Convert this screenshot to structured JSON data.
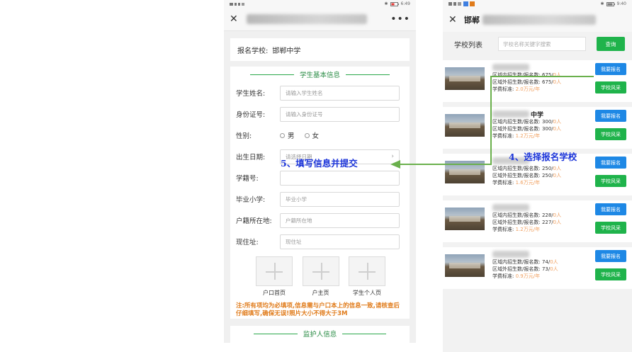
{
  "left_phone": {
    "status_time": "6:49",
    "school_label": "报名学校:",
    "school_value": "邯郸中学",
    "section_student": "学生基本信息",
    "fields": [
      {
        "label": "学生姓名:",
        "placeholder": "请输入学生姓名"
      },
      {
        "label": "身份证号:",
        "placeholder": "请输入身份证号"
      },
      {
        "label": "性别:",
        "options": [
          "男",
          "女"
        ]
      },
      {
        "label": "出生日期:",
        "placeholder": "请选择日期"
      },
      {
        "label": "学籍号:",
        "placeholder": ""
      },
      {
        "label": "毕业小学:",
        "placeholder": "毕业小学"
      },
      {
        "label": "户籍所在地:",
        "placeholder": "户籍所在地"
      },
      {
        "label": "现住址:",
        "placeholder": "现住址"
      }
    ],
    "uploads": [
      "户口首页",
      "户主页",
      "学生个人页"
    ],
    "note": "注:所有项均为必填项,信息需与户口本上的信息一致,请核查后仔细填写,确保无误!照片大小不得大于3M",
    "section_guardian": "监护人信息"
  },
  "right_phone": {
    "status_time": "9:40",
    "title": "邯郸",
    "list_label": "学校列表",
    "search_placeholder": "学校名称关键字搜索",
    "search_button": "查询",
    "items": [
      {
        "name": "",
        "in_quota": "区域内招生数/报名数: 675/",
        "in_count": "0人",
        "out_quota": "区域外招生数/报名数: 675/",
        "out_count": "0人",
        "fee_label": "学费标准:",
        "fee": "2.0万元/年"
      },
      {
        "name": "中学",
        "in_quota": "区域内招生数/报名数: 300/",
        "in_count": "0人",
        "out_quota": "区域外招生数/报名数: 300/",
        "out_count": "0人",
        "fee_label": "学费标准:",
        "fee": "1.2万元/年"
      },
      {
        "name": "",
        "in_quota": "区域内招生数/报名数: 250/",
        "in_count": "0人",
        "out_quota": "区域外招生数/报名数: 250/",
        "out_count": "0人",
        "fee_label": "学费标准:",
        "fee": "1.6万元/年"
      },
      {
        "name": "",
        "in_quota": "区域内招生数/报名数: 228/",
        "in_count": "0人",
        "out_quota": "区域外招生数/报名数: 227/",
        "out_count": "0人",
        "fee_label": "学费标准:",
        "fee": "1.2万元/年"
      },
      {
        "name": "",
        "in_quota": "区域内招生数/报名数: 74/",
        "in_count": "0人",
        "out_quota": "区域外招生数/报名数: 73/",
        "out_count": "0人",
        "fee_label": "学费标准:",
        "fee": "0.9万元/年"
      }
    ],
    "apply_button": "我要报名",
    "style_button": "学校风采"
  },
  "annotations": {
    "step5": "5、填写信息并提交",
    "step4": "4、选择报名学校"
  },
  "colors": {
    "annotation": "#1c35d9",
    "arrow": "#6ab04c",
    "green_button": "#1fb34b",
    "blue_button": "#1e88e5",
    "note_orange": "#e07b1a"
  }
}
